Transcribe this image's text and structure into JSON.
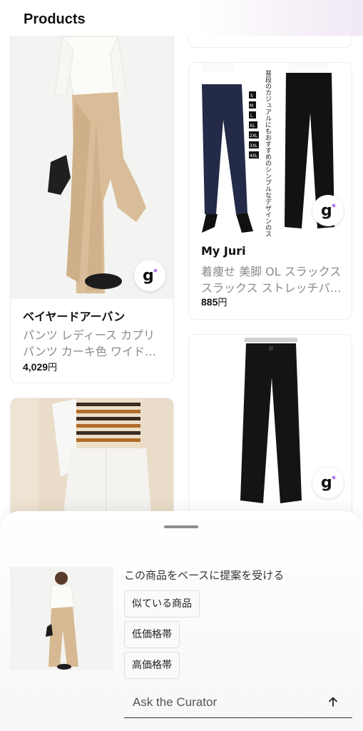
{
  "header": {
    "title": "Products"
  },
  "products": [
    {
      "seller": "ベイヤードアーバン",
      "title": "パンツ レディース カプリパンツ カーキ色 ワイドパンツ",
      "price": "4,029",
      "currency": "円",
      "badge_icon": "brand-g-icon"
    },
    {
      "seller": "My Juri",
      "title": "着痩せ 美脚 OL スラックス スラックス ストレッチパンツ",
      "price": "885",
      "currency": "円",
      "badge_icon": "brand-g-icon",
      "image_caption": "普段のカジュアルにもおすすめのシンプルなデザインのスラックスパンツ。",
      "sizes": [
        "S",
        "M",
        "L",
        "XL",
        "2XL",
        "3XL",
        "4XL"
      ]
    },
    {
      "badge_icon": "brand-g-icon"
    }
  ],
  "curator": {
    "suggest_title": "この商品をベースに提案を受ける",
    "chips": [
      "似ている商品",
      "低価格帯",
      "高価格帯"
    ],
    "input_placeholder": "Ask the Curator",
    "send_icon": "arrow-up-icon"
  },
  "colors": {
    "accent_purple": "#b47cf5",
    "text_muted": "#8a8a8a",
    "card_border": "#ececec"
  }
}
